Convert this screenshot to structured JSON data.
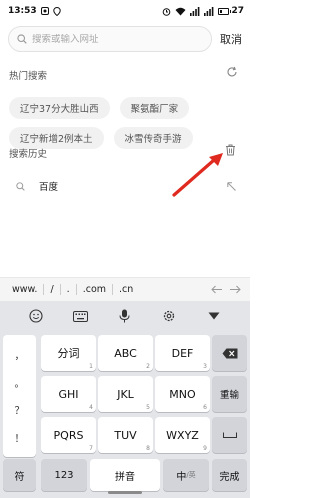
{
  "status_bar": {
    "time": "13:53",
    "battery": "27",
    "battery_level": 0.27
  },
  "search": {
    "placeholder": "搜索或输入网址",
    "cancel_label": "取消"
  },
  "hot_search": {
    "title": "热门搜索",
    "tags": [
      "辽宁37分大胜山西",
      "聚氨酯厂家",
      "辽宁新增2例本土",
      "冰雪传奇手游"
    ]
  },
  "history": {
    "title": "搜索历史",
    "items": [
      {
        "label": "百度"
      }
    ]
  },
  "url_bar": {
    "keys": [
      "www.",
      "/",
      ".",
      ".com",
      ".cn"
    ]
  },
  "keyboard": {
    "punct": [
      "，",
      "。",
      "？",
      "！"
    ],
    "rows": [
      [
        {
          "main": "分词",
          "sub": "1"
        },
        {
          "main": "ABC",
          "sub": "2"
        },
        {
          "main": "DEF",
          "sub": "3"
        }
      ],
      [
        {
          "main": "GHI",
          "sub": "4"
        },
        {
          "main": "JKL",
          "sub": "5"
        },
        {
          "main": "MNO",
          "sub": "6"
        }
      ],
      [
        {
          "main": "PQRS",
          "sub": "7"
        },
        {
          "main": "TUV",
          "sub": "8"
        },
        {
          "main": "WXYZ",
          "sub": "9"
        }
      ]
    ],
    "retype_label": "重输",
    "bottom": {
      "symbol": "符",
      "num": "123",
      "pinyin": "拼音",
      "lang": "中",
      "lang_sub": "/英",
      "done": "完成"
    }
  }
}
